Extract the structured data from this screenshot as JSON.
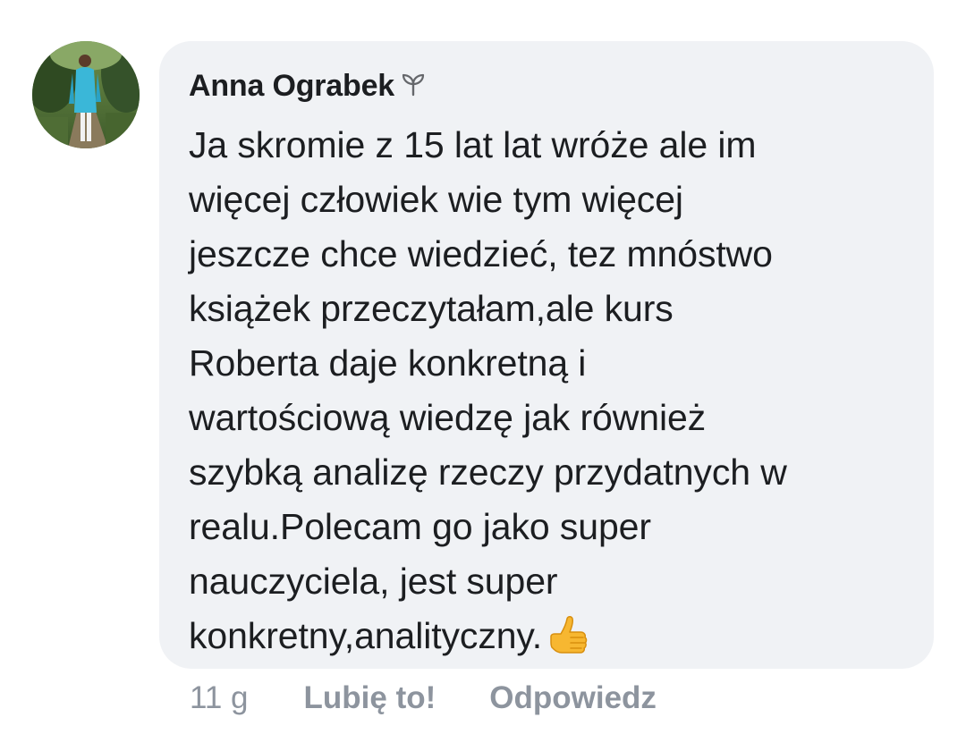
{
  "comment": {
    "author": "Anna Ograbek",
    "author_badge_icon": "new-member-sprout-icon",
    "text": "Ja skromie z 15 lat lat wróże ale im\nwięcej człowiek wie  tym więcej\njeszcze chce wiedzieć, tez mnóstwo\nksiążek przeczytałam,ale kurs\nRoberta daje konkretną i\nwartościową wiedzę jak również\nszybką analizę rzeczy przydatnych w\nrealu.Polecam go jako super\nnauczyciela, jest super\nkonkretny,analityczny.",
    "trailing_emoji_icon": "thumbs-up-emoji-icon"
  },
  "actions": {
    "timestamp": "11 g",
    "like_label": "Lubię to!",
    "reply_label": "Odpowiedz"
  },
  "colors": {
    "bubble_bg": "#f0f2f5",
    "text": "#1c1e21",
    "secondary": "#8d949e"
  }
}
